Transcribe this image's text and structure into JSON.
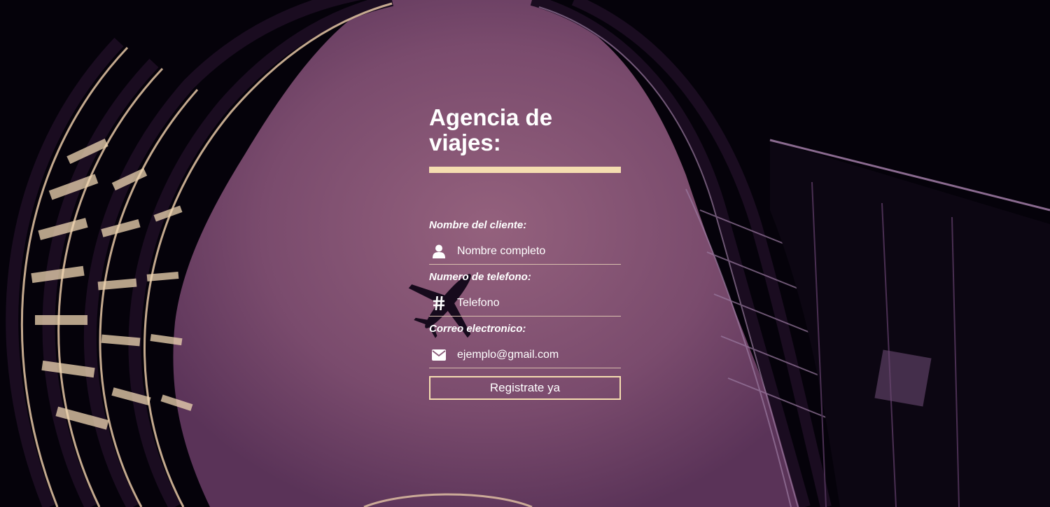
{
  "page": {
    "title": "Agencia de viajes:"
  },
  "form": {
    "fields": [
      {
        "label": "Nombre del cliente:",
        "placeholder": "Nombre completo",
        "icon": "user-icon"
      },
      {
        "label": "Numero de telefono:",
        "placeholder": "Telefono",
        "icon": "hashtag-icon"
      },
      {
        "label": "Correo electronico:",
        "placeholder": "ejemplo@gmail.com",
        "icon": "envelope-icon"
      }
    ],
    "submit_label": "Registrate ya"
  },
  "colors": {
    "accent": "#f5ddb0",
    "sky": "#8e5b78",
    "shadow": "#06020a"
  }
}
